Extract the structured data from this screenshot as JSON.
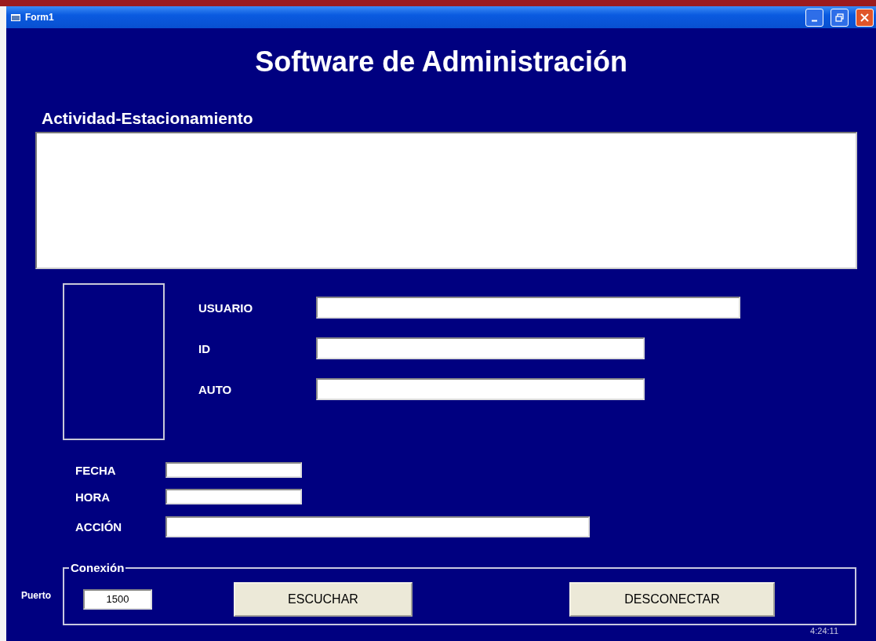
{
  "window": {
    "title": "Form1"
  },
  "heading": "Software de Administración",
  "activity": {
    "label": "Actividad-Estacionamiento"
  },
  "user_fields": [
    {
      "label": "USUARIO"
    },
    {
      "label": "ID"
    },
    {
      "label": "AUTO"
    }
  ],
  "record_fields": [
    {
      "label": "FECHA"
    },
    {
      "label": "HORA"
    },
    {
      "label": "ACCIÓN"
    }
  ],
  "connection": {
    "title": "Conexión",
    "port_label": "Puerto",
    "port_value": "1500",
    "buttons": [
      "ESCUCHAR",
      "DESCONECTAR"
    ]
  },
  "clock": "4:24:11"
}
